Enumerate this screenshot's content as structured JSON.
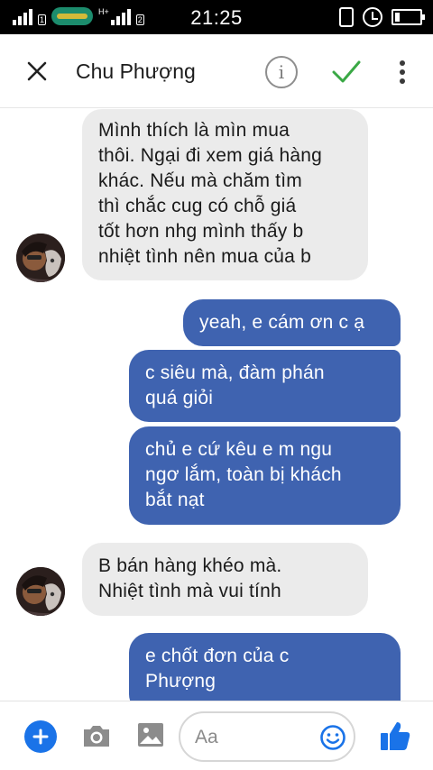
{
  "status_bar": {
    "time": "21:25",
    "sim1": "1",
    "sim2": "2",
    "network": "H+"
  },
  "header": {
    "title": "Chu Phượng",
    "info_label": "i",
    "accent": "#3aa845"
  },
  "messages": [
    {
      "direction": "incoming",
      "lines": [
        "Mình thích là mìn mua",
        "thôi. Ngại đi xem giá hàng",
        "khác. Nếu mà chăm tìm",
        "thì chắc cug có chỗ giá",
        "tốt hơn nhg mình thấy b",
        "nhiệt tình nên mua của b"
      ]
    },
    {
      "direction": "outgoing",
      "lines": [
        "yeah, e cám ơn c ạ"
      ]
    },
    {
      "direction": "outgoing",
      "lines": [
        "c siêu mà, đàm phán",
        "quá giỏi"
      ]
    },
    {
      "direction": "outgoing",
      "lines": [
        "chủ e cứ kêu e m ngu",
        "ngơ lắm, toàn bị khách",
        "bắt nạt"
      ]
    },
    {
      "direction": "incoming",
      "lines": [
        "B bán hàng khéo mà.",
        "Nhiệt tình mà vui tính"
      ]
    },
    {
      "direction": "outgoing",
      "lines": [
        "e chốt đơn của c",
        "Phượng"
      ]
    }
  ],
  "composer": {
    "placeholder": "Aa"
  },
  "colors": {
    "outgoing_bubble": "#3f63b0",
    "incoming_bubble": "#ebebeb",
    "brand_blue": "#1a73e8"
  }
}
